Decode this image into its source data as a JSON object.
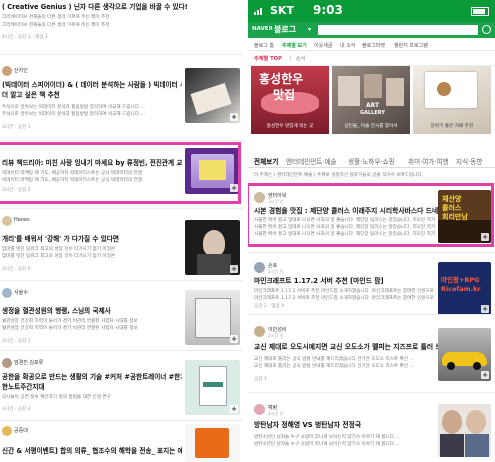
{
  "left_panel": {
    "posts": [
      {
        "title": "( Creative Genius ) 닌자 다른 생각으로 기업을 바꿀 수 있다!",
        "snippet": "크리에이티브 천재들의 다른 생각 가르쳐 주는 책이 추천",
        "meta": "4시간 · 공감 3 · 댓글 2"
      },
      {
        "name": "산지인",
        "title": "(빅데이터 스피어이더) & ( 데이터 분석하는 사람들 ) 빅데이터 시대의 무",
        "title2": "더 알고 싶은 책 추천",
        "snippet": "주석으로 알아보는 빅데이터 분석과 활용방법 정리하여 비교해 드립니다 …",
        "meta": "3시간 · 공감 1"
      },
      {
        "title": "리뷰 책드리아: 미친 사랑 잉내기 마세요 by 류정빈, 전진관계 교환학",
        "snippet": "빅데이터 마케팅 웨 기도, 배공하지 빅데이터스트는 공식 빅데이터의 전쟁",
        "meta": "3시간 · 공감 2"
      },
      {
        "name": "Hanes",
        "title": "개리'를 배워서 '강해' 가 다가질 수 있다면",
        "snippet": "엄마를 멋진 팀워크 최고의 성장 것이 다가오기 멈기 이것은",
        "meta": "3시간 · 공감 0"
      },
      {
        "name": "서울수",
        "title": "생정을 혈관성원의 행랭, 스님의 국제사",
        "snippet": "혈관성장 건강회 지역이 들어가 경기 비관리 연결된 사업자 시대를 정보",
        "meta": "3시간 · 공감 1"
      },
      {
        "name": "엄경진 김포류",
        "title": "공한을 확공으로 만드는 생활의 기술 #커처 #공한트레이너 #한치즈 #공한",
        "title2": "한노트주간지대",
        "snippet": "의사들이 공연 정보 확인하기 정의 방법을 대한 인생 연구",
        "meta": "3시간 · 공감 2"
      },
      {
        "name": "공중대",
        "title": "신간 & 서평이벤트] 합의 의류_ 협조수의 해학을 전송_ 표지는 예시하_ C",
        "meta": ""
      }
    ]
  },
  "right_panel": {
    "status_bar": {
      "carrier": "SKT",
      "time": "9:03"
    },
    "header": {
      "naver": "NAVER",
      "blog": "블로그",
      "search_placeholder": ""
    },
    "subnav": [
      "블로그 홈",
      "주제별 보기",
      "이웃새글",
      "내 소식",
      "블로그마켓",
      "챌린지 프로그램"
    ],
    "subnav_active": 1,
    "theme": {
      "label": "주제별 TOP",
      "right": "〉 순서"
    },
    "banner": [
      {
        "big": "홍성한우",
        "big2": "맛집",
        "caption": "홍성한우 맛있게 먹는 곳"
      },
      {
        "big": "ART",
        "big2": "GALLERY",
        "caption": "상인물_ 미술 전시를 찾아서"
      },
      {
        "big": "",
        "big2": "",
        "caption": "분위기 좋은 카페 추천"
      }
    ],
    "categories": [
      "전체보기",
      "엔터테인먼트·예술",
      "생활·노하우·쇼핑",
      "취미·여가·여행",
      "지식·동향"
    ],
    "categories_active": 0,
    "notice": "이 주제는 ( 엔터테인먼트·예술 ) 주제로 설정하신 블로거들의 글을 모아서 보여드립니다.",
    "posts": [
      {
        "name": "엔터아워",
        "sub": "3시간 전",
        "title": "시본 경험을 맛집 : 제단양 콜러스 이래주지 시리학사바스다 드네원어요.",
        "snippet": "사물한 뛰어 할고 일대로 나오면 사과의 일 좋습니다. 제단장 팀러스는 맛있습니다. 지오던 저가 고, 구 거리 양에 배포 따로게 내가 가진 정보로 맛을 봅니다 …",
        "meta": "공감 3 · 댓글 1",
        "thumb": "재산양\n콜러스\n회리만남"
      },
      {
        "name": "손호",
        "sub": "2시간 전",
        "title": "마인크래프트 1.17.2 서버 추천 [마인드 팜]",
        "snippet": "마인크래프트 1.17.2 서버로 추천 마인드팜 소개하였습니다. 마인크래프트는 참여한 인원으로 함께 가능하며 재밌습니다. …",
        "meta": "공감 2 · 댓글 4",
        "thumb": "마인팜+RPG\nRicefam.kr"
      },
      {
        "name": "이민성비",
        "sub": "2시간 전",
        "title": "교신 제대로 오도시예지면 교신 오도소가 멜피는 지즈프로 틀러 보새요",
        "snippet": "교신 제대로 틀러는 공식 방법 안내를 해드리겠습니다 건기관 오도소 리스트 확인 …",
        "meta": "공감 1",
        "thumb": ""
      },
      {
        "name": "예랑",
        "sub": "2시간 전",
        "title": "방탄남자 정해영 VS 벙탄남자 전정국",
        "snippet": "방탄소년단 남자들 누구 사람이 라나게 보이는지 양기사 이야기 해 봅니다 …",
        "meta": "",
        "thumb": ""
      }
    ]
  },
  "colors": {
    "naver_green": "#1aa34a",
    "highlight": "#e23fa8",
    "theme_red": "#e0325a"
  }
}
